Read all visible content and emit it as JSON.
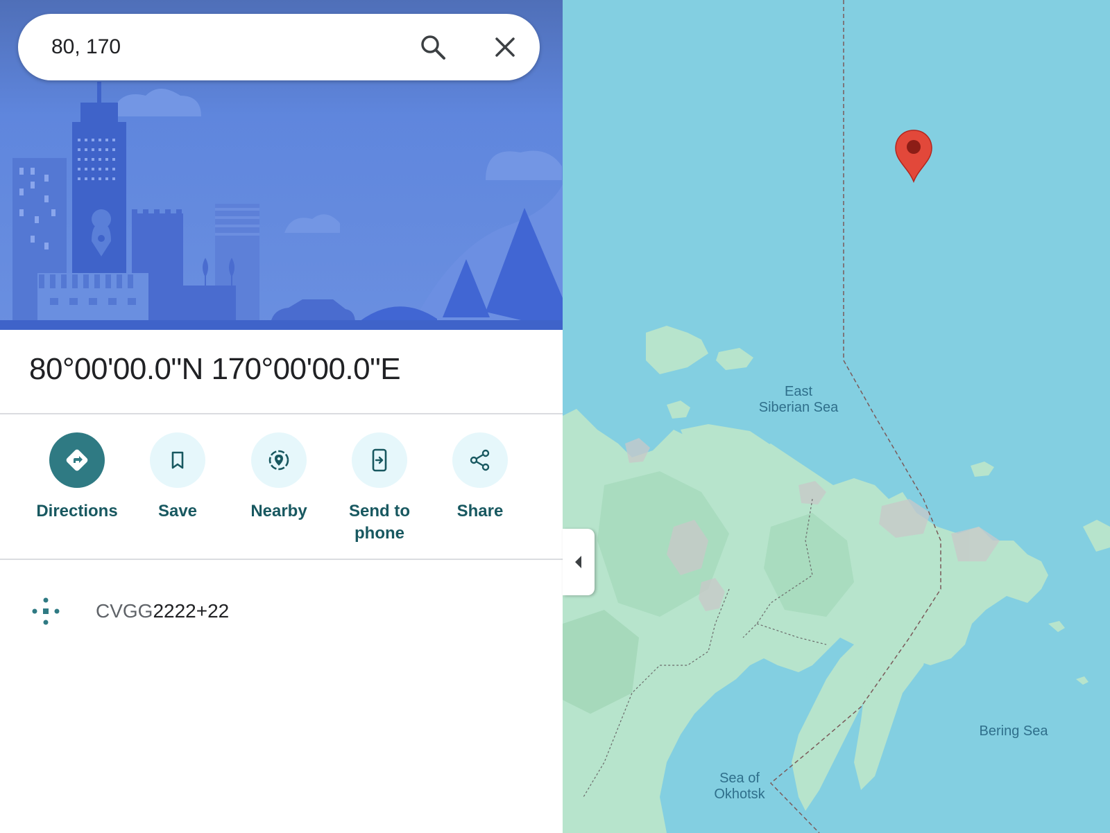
{
  "search": {
    "value": "80, 170",
    "search_icon": "search-icon",
    "clear_icon": "close-icon"
  },
  "place": {
    "title": "80°00'00.0\"N 170°00'00.0\"E"
  },
  "actions": [
    {
      "label": "Directions",
      "icon": "directions-icon",
      "primary": true
    },
    {
      "label": "Save",
      "icon": "bookmark-icon"
    },
    {
      "label": "Nearby",
      "icon": "nearby-icon"
    },
    {
      "label": "Send to phone",
      "icon": "send-to-phone-icon"
    },
    {
      "label": "Share",
      "icon": "share-icon"
    }
  ],
  "plus_code": {
    "prefix": "CVGG",
    "suffix": "2222+22",
    "icon": "plus-code-icon"
  },
  "map": {
    "labels": {
      "east_siberian_line1": "East",
      "east_siberian_line2": "Siberian Sea",
      "bering": "Bering Sea",
      "okhotsk_line1": "Sea of",
      "okhotsk_line2": "Okhotsk"
    },
    "pin_icon": "map-pin-icon",
    "collapse_icon": "collapse-panel-icon"
  },
  "colors": {
    "hero_sky": "#5f86dd",
    "water": "#83cfe1",
    "land": "#b7e4cc",
    "action_primary": "#2f7a83",
    "action_secondary": "#e6f7fb",
    "action_label": "#185860",
    "pin": "#e2483a"
  }
}
